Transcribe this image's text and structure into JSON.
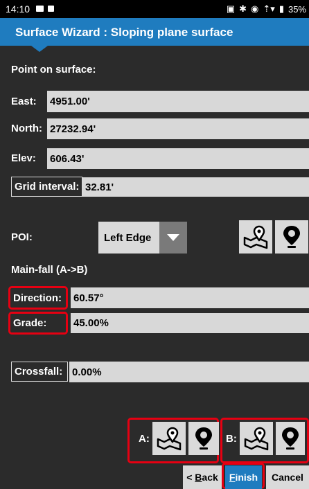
{
  "status_bar": {
    "time": "14:10",
    "battery": "35%"
  },
  "title": "Surface Wizard : Sloping plane surface",
  "point_section": "Point on surface:",
  "east": {
    "label": "East:",
    "value": "4951.00'"
  },
  "north": {
    "label": "North:",
    "value": "27232.94'"
  },
  "elev": {
    "label": "Elev:",
    "value": "606.43'"
  },
  "grid": {
    "label": "Grid interval:",
    "value": "32.81'"
  },
  "poi": {
    "label": "POI:",
    "selected": "Left Edge"
  },
  "mainfall_section": "Main-fall (A->B)",
  "direction": {
    "label": "Direction:",
    "value": "60.57°"
  },
  "grade": {
    "label": "Grade:",
    "value": "45.00%"
  },
  "crossfall": {
    "label": "Crossfall:",
    "value": "0.00%"
  },
  "point_a_label": "A:",
  "point_b_label": "B:",
  "buttons": {
    "back_prefix": "< ",
    "back_key": "B",
    "back_rest": "ack",
    "finish_key": "F",
    "finish_rest": "inish",
    "cancel": "Cancel"
  },
  "colors": {
    "title_bar": "#1f7cbf",
    "background": "#2b2b2b",
    "field": "#d8d8d8",
    "highlight": "#e60012"
  },
  "icons": [
    "map-pick-icon",
    "location-pin-icon",
    "dropdown-arrow-icon"
  ]
}
